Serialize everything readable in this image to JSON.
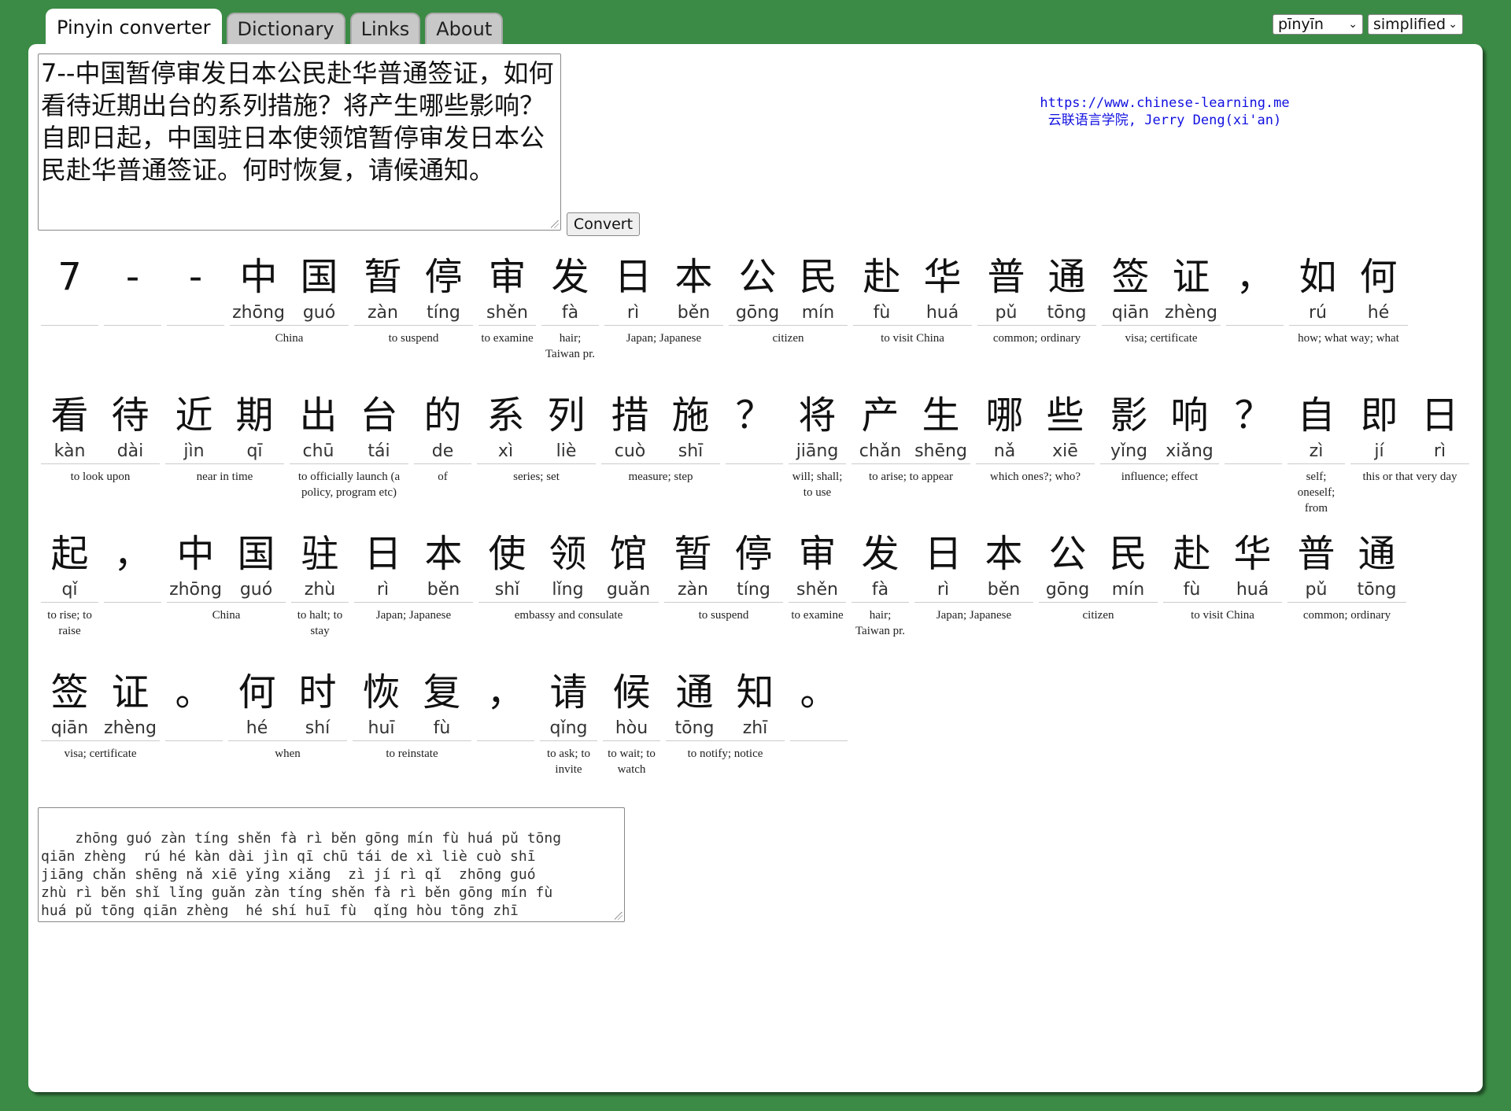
{
  "tabs": [
    "Pinyin converter",
    "Dictionary",
    "Links",
    "About"
  ],
  "selects": {
    "mode": "pīnyīn",
    "script": "simplified"
  },
  "input_text": "7--中国暂停审发日本公民赴华普通签证，如何看待近期出台的系列措施？将产生哪些影响？自即日起，中国驻日本使领馆暂停审发日本公民赴华普通签证。何时恢复，请候通知。",
  "convert_label": "Convert",
  "credit": {
    "url": "https://www.chinese-learning.me",
    "line2": "云联语言学院, Jerry Deng(xi'an)"
  },
  "rows": [
    [
      {
        "h": [
          "7"
        ],
        "p": [
          ""
        ],
        "d": ""
      },
      {
        "h": [
          "-"
        ],
        "p": [
          ""
        ],
        "d": ""
      },
      {
        "h": [
          "-"
        ],
        "p": [
          ""
        ],
        "d": ""
      },
      {
        "h": [
          "中",
          "国"
        ],
        "p": [
          "zhōng",
          "guó"
        ],
        "d": "China"
      },
      {
        "h": [
          "暂",
          "停"
        ],
        "p": [
          "zàn",
          "tíng"
        ],
        "d": "to suspend"
      },
      {
        "h": [
          "审"
        ],
        "p": [
          "shěn"
        ],
        "d": "to examine"
      },
      {
        "h": [
          "发"
        ],
        "p": [
          "fà"
        ],
        "d": "hair; Taiwan pr."
      },
      {
        "h": [
          "日",
          "本"
        ],
        "p": [
          "rì",
          "běn"
        ],
        "d": "Japan; Japanese"
      },
      {
        "h": [
          "公",
          "民"
        ],
        "p": [
          "gōng",
          "mín"
        ],
        "d": "citizen"
      },
      {
        "h": [
          "赴",
          "华"
        ],
        "p": [
          "fù",
          "huá"
        ],
        "d": "to visit China"
      },
      {
        "h": [
          "普",
          "通"
        ],
        "p": [
          "pǔ",
          "tōng"
        ],
        "d": "common; ordinary"
      },
      {
        "h": [
          "签",
          "证"
        ],
        "p": [
          "qiān",
          "zhèng"
        ],
        "d": "visa; certificate"
      },
      {
        "h": [
          "，"
        ],
        "p": [
          ""
        ],
        "d": ""
      },
      {
        "h": [
          "如",
          "何"
        ],
        "p": [
          "rú",
          "hé"
        ],
        "d": "how; what way; what"
      }
    ],
    [
      {
        "h": [
          "看",
          "待"
        ],
        "p": [
          "kàn",
          "dài"
        ],
        "d": "to look upon"
      },
      {
        "h": [
          "近",
          "期"
        ],
        "p": [
          "jìn",
          "qī"
        ],
        "d": "near in time"
      },
      {
        "h": [
          "出",
          "台"
        ],
        "p": [
          "chū",
          "tái"
        ],
        "d": "to officially launch (a policy, program etc)"
      },
      {
        "h": [
          "的"
        ],
        "p": [
          "de"
        ],
        "d": "of"
      },
      {
        "h": [
          "系",
          "列"
        ],
        "p": [
          "xì",
          "liè"
        ],
        "d": "series; set"
      },
      {
        "h": [
          "措",
          "施"
        ],
        "p": [
          "cuò",
          "shī"
        ],
        "d": "measure; step"
      },
      {
        "h": [
          "？"
        ],
        "p": [
          ""
        ],
        "d": ""
      },
      {
        "h": [
          "将"
        ],
        "p": [
          "jiāng"
        ],
        "d": "will; shall; to use"
      },
      {
        "h": [
          "产",
          "生"
        ],
        "p": [
          "chǎn",
          "shēng"
        ],
        "d": "to arise; to appear"
      },
      {
        "h": [
          "哪",
          "些"
        ],
        "p": [
          "nǎ",
          "xiē"
        ],
        "d": "which ones?; who?"
      },
      {
        "h": [
          "影",
          "响"
        ],
        "p": [
          "yǐng",
          "xiǎng"
        ],
        "d": "influence; effect"
      },
      {
        "h": [
          "？"
        ],
        "p": [
          ""
        ],
        "d": ""
      },
      {
        "h": [
          "自"
        ],
        "p": [
          "zì"
        ],
        "d": "self; oneself; from"
      },
      {
        "h": [
          "即",
          "日"
        ],
        "p": [
          "jí",
          "rì"
        ],
        "d": "this or that very day"
      }
    ],
    [
      {
        "h": [
          "起"
        ],
        "p": [
          "qǐ"
        ],
        "d": "to rise; to raise"
      },
      {
        "h": [
          "，"
        ],
        "p": [
          ""
        ],
        "d": ""
      },
      {
        "h": [
          "中",
          "国"
        ],
        "p": [
          "zhōng",
          "guó"
        ],
        "d": "China"
      },
      {
        "h": [
          "驻"
        ],
        "p": [
          "zhù"
        ],
        "d": "to halt; to stay"
      },
      {
        "h": [
          "日",
          "本"
        ],
        "p": [
          "rì",
          "běn"
        ],
        "d": "Japan; Japanese"
      },
      {
        "h": [
          "使",
          "领",
          "馆"
        ],
        "p": [
          "shǐ",
          "lǐng",
          "guǎn"
        ],
        "d": "embassy and consulate"
      },
      {
        "h": [
          "暂",
          "停"
        ],
        "p": [
          "zàn",
          "tíng"
        ],
        "d": "to suspend"
      },
      {
        "h": [
          "审"
        ],
        "p": [
          "shěn"
        ],
        "d": "to examine"
      },
      {
        "h": [
          "发"
        ],
        "p": [
          "fà"
        ],
        "d": "hair; Taiwan pr."
      },
      {
        "h": [
          "日",
          "本"
        ],
        "p": [
          "rì",
          "běn"
        ],
        "d": "Japan; Japanese"
      },
      {
        "h": [
          "公",
          "民"
        ],
        "p": [
          "gōng",
          "mín"
        ],
        "d": "citizen"
      },
      {
        "h": [
          "赴",
          "华"
        ],
        "p": [
          "fù",
          "huá"
        ],
        "d": "to visit China"
      },
      {
        "h": [
          "普",
          "通"
        ],
        "p": [
          "pǔ",
          "tōng"
        ],
        "d": "common; ordinary"
      }
    ],
    [
      {
        "h": [
          "签",
          "证"
        ],
        "p": [
          "qiān",
          "zhèng"
        ],
        "d": "visa; certificate"
      },
      {
        "h": [
          "。"
        ],
        "p": [
          ""
        ],
        "d": ""
      },
      {
        "h": [
          "何",
          "时"
        ],
        "p": [
          "hé",
          "shí"
        ],
        "d": "when"
      },
      {
        "h": [
          "恢",
          "复"
        ],
        "p": [
          "huī",
          "fù"
        ],
        "d": "to reinstate"
      },
      {
        "h": [
          "，"
        ],
        "p": [
          ""
        ],
        "d": ""
      },
      {
        "h": [
          "请"
        ],
        "p": [
          "qǐng"
        ],
        "d": "to ask; to invite"
      },
      {
        "h": [
          "候"
        ],
        "p": [
          "hòu"
        ],
        "d": "to wait; to watch"
      },
      {
        "h": [
          "通",
          "知"
        ],
        "p": [
          "tōng",
          "zhī"
        ],
        "d": "to notify; notice"
      },
      {
        "h": [
          "。"
        ],
        "p": [
          ""
        ],
        "d": ""
      }
    ]
  ],
  "output_text": "  zhōng guó zàn tíng shěn fà rì běn gōng mín fù huá pǔ tōng\nqiān zhèng  rú hé kàn dài jìn qī chū tái de xì liè cuò shī\njiāng chǎn shēng nǎ xiē yǐng xiǎng  zì jí rì qǐ  zhōng guó\nzhù rì běn shǐ lǐng guǎn zàn tíng shěn fà rì běn gōng mín fù\nhuá pǔ tōng qiān zhèng  hé shí huī fù  qǐng hòu tōng zhī"
}
